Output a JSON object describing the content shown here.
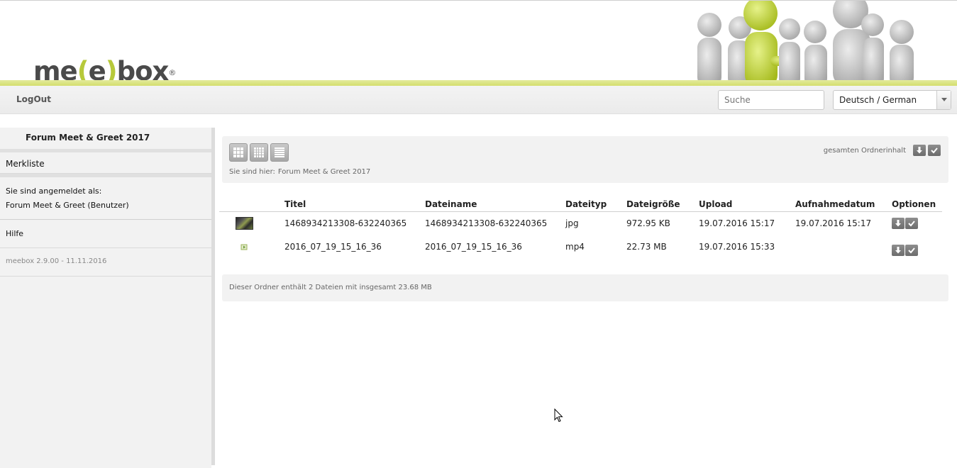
{
  "header": {
    "logo": {
      "part1": "me",
      "bracket_open": "(",
      "part2": "e",
      "bracket_close": ")",
      "part3": "box",
      "reg": "®"
    }
  },
  "nav": {
    "logout_label": "LogOut",
    "search_placeholder": "Suche",
    "language_selected": "Deutsch / German"
  },
  "sidebar": {
    "folder": "Forum Meet & Greet 2017",
    "watchlist": "Merkliste",
    "logged_in_label": "Sie sind angemeldet als:",
    "logged_in_user": "Forum Meet & Greet (Benutzer)",
    "help": "Hilfe",
    "version": "meebox 2.9.00 - 11.11.2016"
  },
  "toolbar": {
    "breadcrumb_label": "Sie sind hier:",
    "breadcrumb_current": "Forum Meet & Greet 2017",
    "folder_content_label": "gesamten Ordnerinhalt"
  },
  "table": {
    "columns": [
      "Titel",
      "Dateiname",
      "Dateityp",
      "Dateigröße",
      "Upload",
      "Aufnahmedatum",
      "Optionen"
    ],
    "rows": [
      {
        "title": "1468934213308-632240365",
        "filename": "1468934213308-632240365",
        "type": "jpg",
        "size": "972.95 KB",
        "upload": "19.07.2016 15:17",
        "recorded": "19.07.2016 15:17",
        "thumb": "image-thumbnail"
      },
      {
        "title": "2016_07_19_15_16_36",
        "filename": "2016_07_19_15_16_36",
        "type": "mp4",
        "size": "22.73 MB",
        "upload": "19.07.2016 15:33",
        "recorded": "",
        "thumb": "video-icon"
      }
    ]
  },
  "footer": {
    "summary": "Dieser Ordner enthält 2 Dateien mit insgesamt 23.68 MB"
  },
  "colors": {
    "accent_lime": "#b7c93b",
    "stripe": "#d2dd68",
    "panel_bg": "#f2f2f2",
    "icon_button": "#7a7a7a"
  }
}
